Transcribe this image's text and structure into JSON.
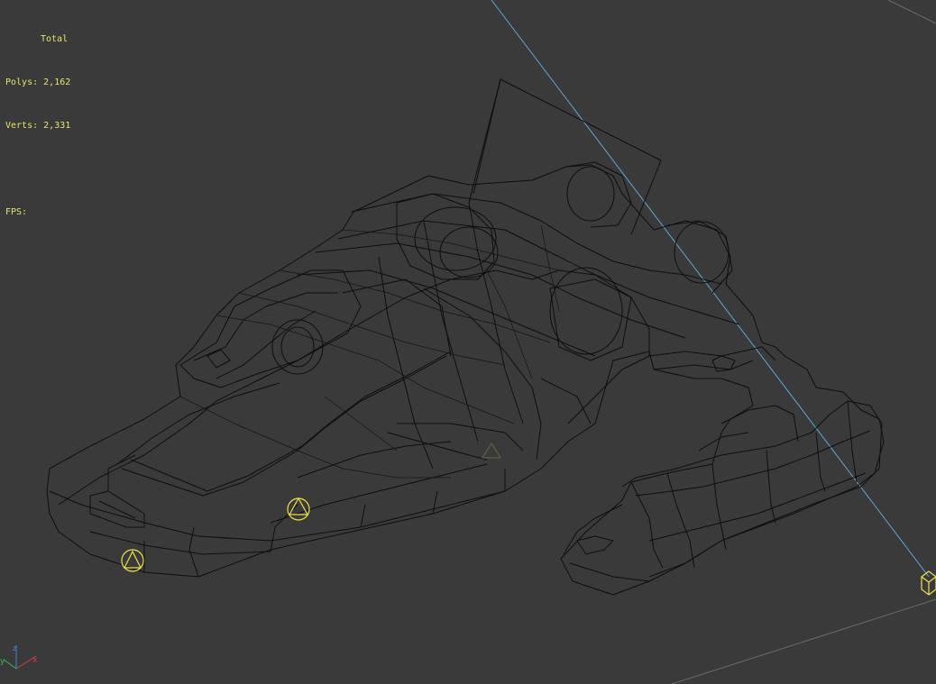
{
  "viewport": {
    "name": "Perspective viewport",
    "render_mode": "wireframe",
    "background_color": "#3a3a3a",
    "wire_color": "#0e0e0e",
    "grid_color": "#6a6a6a",
    "light_line_color": "#5aa8d8",
    "helper_color": "#f0e24a"
  },
  "stats": {
    "header": "Total",
    "polys_label": "Polys:",
    "polys_value": "2,162",
    "verts_label": "Verts:",
    "verts_value": "2,331",
    "fps_label": "FPS:",
    "fps_value": ""
  },
  "scene": {
    "object": "spaceship-wireframe-model",
    "helpers": [
      "dummy-helper",
      "dummy-helper",
      "dummy-helper",
      "box-helper"
    ],
    "gizmo": [
      "x-axis",
      "y-axis",
      "z-axis"
    ]
  }
}
